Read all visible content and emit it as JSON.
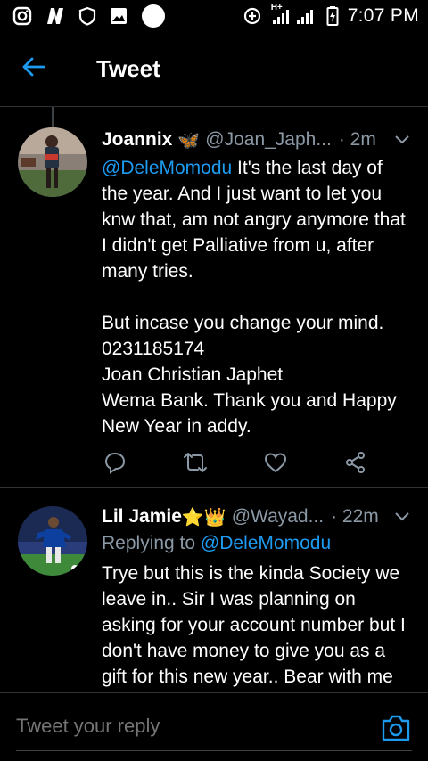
{
  "status_bar": {
    "time": "7:07 PM",
    "network": "H+"
  },
  "header": {
    "title": "Tweet",
    "back_icon": "arrow-left-icon"
  },
  "tweets": [
    {
      "name": "Joannix",
      "emoji": "🦋",
      "handle": "@Joan_Japh...",
      "time": "· 2m",
      "mention": "@DeleMomodu",
      "text_after_mention": " It's the last day of the year. And I just want to let you knw that, am not angry anymore that I didn't get Palliative from u, after many tries.\n\nBut incase you change your mind.\n0231185174\nJoan Christian Japhet\nWema Bank. Thank you and Happy New Year in addy."
    },
    {
      "name": "Lil Jamie",
      "emoji": "⭐👑",
      "handle": "@Wayad...",
      "time": "· 22m",
      "replying_label": "Replying to",
      "replying_to": "@DeleMomodu",
      "text": "Trye but this is the kinda Society we leave in.. Sir I was planning on asking for your account number but I don't have money to give you as a gift for this new year.. Bear with me"
    }
  ],
  "reply_bar": {
    "placeholder": "Tweet your reply"
  },
  "colors": {
    "accent": "#1d9bf0",
    "muted": "#8b98a5",
    "background": "#000000"
  }
}
